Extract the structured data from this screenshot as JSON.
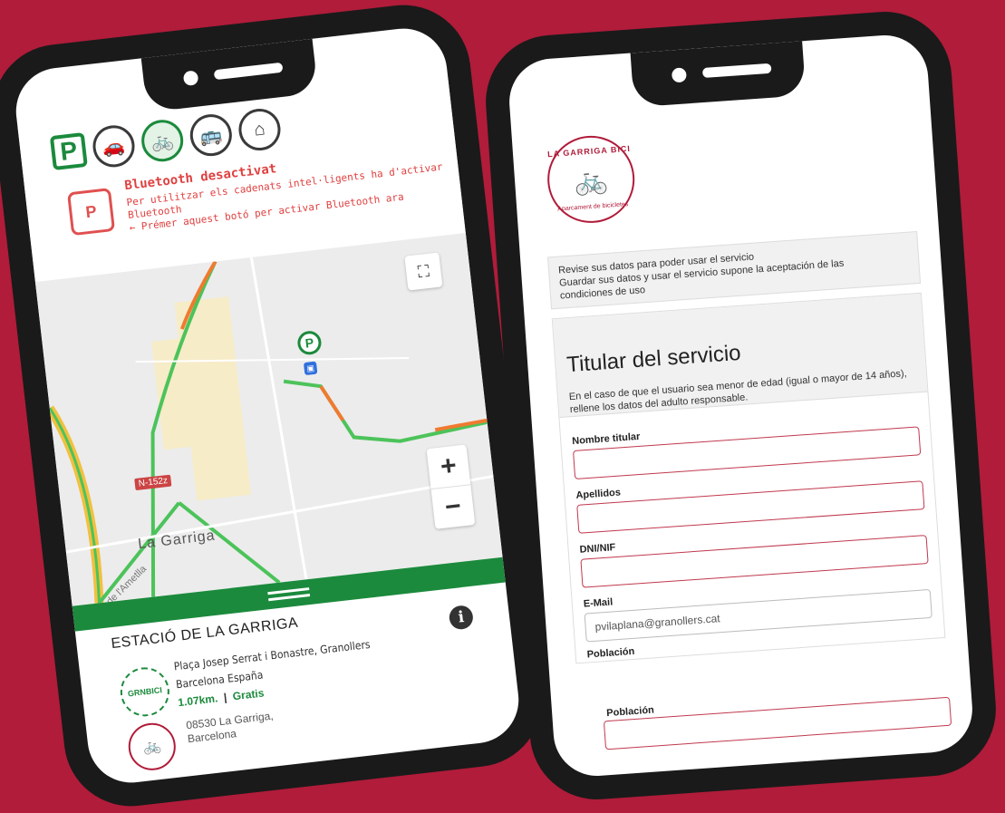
{
  "app": {
    "bluetooth_title": "Bluetooth desactivat",
    "bluetooth_line1": "Per utilitzar els cadenats intel·ligents ha d'activar",
    "bluetooth_line2": "Bluetooth",
    "bluetooth_line3": "← Prémer aquest botó per activar Bluetooth ara",
    "map": {
      "town": "La Garriga",
      "road_badge": "N-152z",
      "road_name": "de l'Ametlla"
    },
    "station": {
      "name": "ESTACIÓ DE LA GARRIGA",
      "address_line1": "Plaça Josep Serrat i Bonastre, Granollers",
      "address_line2": "Barcelona España",
      "distance": "1.07km.",
      "separator": "|",
      "price": "Gratis",
      "postal_line1": "08530 La Garriga,",
      "postal_line2": "Barcelona",
      "gran_logo_text": "GRNBICI"
    }
  },
  "form": {
    "logo_top": "LA GARRIGA BICI",
    "logo_bottom": "Aparcament de bicicletes",
    "notice_line1": "Revise sus datos para poder usar el servicio",
    "notice_line2": "Guardar sus datos y usar el servicio supone la aceptación de las",
    "notice_line3": "condiciones de uso",
    "title": "Titular del servicio",
    "subtitle": "En el caso de que el usuario sea menor de edad (igual o mayor de 14 años), rellene los datos del adulto responsable.",
    "fields": {
      "nombre": "Nombre titular",
      "apellidos": "Apellidos",
      "dni": "DNI/NIF",
      "email": "E-Mail",
      "email_value": "pvilaplana@granollers.cat",
      "poblacion": "Población"
    }
  },
  "colors": {
    "brand_red": "#b01c3a",
    "accent_green": "#1b8a3c",
    "alert_red": "#e04040"
  }
}
